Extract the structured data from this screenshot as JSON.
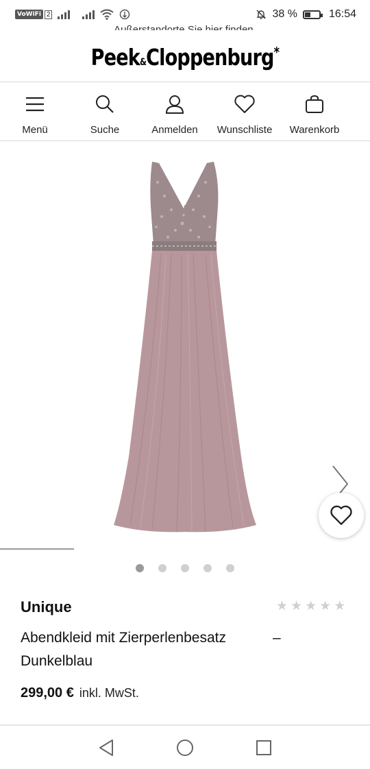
{
  "status_bar": {
    "vowifi": "VoWiFi",
    "sim": "2",
    "battery": "38 %",
    "battery_level": 0.38,
    "time": "16:54"
  },
  "header": {
    "cut_text_before": "Außerstandorte Sie",
    "cut_link": "hier",
    "cut_text_after": "finden.",
    "logo_part1": "Peek",
    "logo_amp": "&",
    "logo_part2": "Cloppenburg",
    "logo_star": "*"
  },
  "nav": {
    "items": [
      {
        "label": "Menü",
        "icon": "hamburger-icon"
      },
      {
        "label": "Suche",
        "icon": "search-icon"
      },
      {
        "label": "Anmelden",
        "icon": "user-icon"
      },
      {
        "label": "Wunschliste",
        "icon": "heart-icon"
      },
      {
        "label": "Warenkorb",
        "icon": "bag-icon"
      }
    ]
  },
  "gallery": {
    "image_description_icon": "dress-image",
    "dots_total": 5,
    "active_dot": 0
  },
  "product": {
    "brand": "Unique",
    "name": "Abendkleid mit Zierperlenbesatz",
    "name_line2": "Dunkelblau",
    "dash": "–",
    "rating": 0,
    "rating_max": 5,
    "price": "299,00 €",
    "tax_note": "inkl. MwSt."
  },
  "colors": {
    "dress": "#b8979c",
    "bodice": "#9d8a8c",
    "star_empty": "#d0d0d0",
    "dot_active": "#9a9a9a",
    "dot_inactive": "#d0d0d0"
  }
}
